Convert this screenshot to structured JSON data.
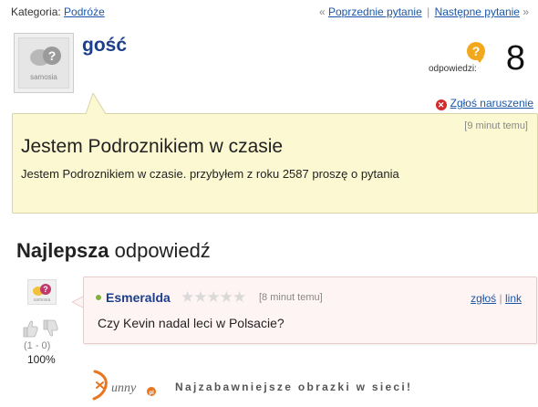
{
  "nav": {
    "category_label": "Kategoria:",
    "category_link": "Podróże",
    "prev_prefix": "«",
    "prev_link": "Poprzednie pytanie",
    "separator": "|",
    "next_link": "Następne pytanie",
    "next_suffix": "»"
  },
  "asker": {
    "avatar_brand": "samosia",
    "name": "gość"
  },
  "answers": {
    "label": "odpowiedzi:",
    "count": "8"
  },
  "report": {
    "label": "Zgłoś naruszenie"
  },
  "question": {
    "time": "[9 minut temu]",
    "title": "Jestem Podroznikiem w czasie",
    "body": "Jestem Podroznikiem w czasie. przybyłem z roku 2587 proszę o pytania"
  },
  "best_answer": {
    "heading_bold": "Najlepsza",
    "heading_rest": " odpowiedź",
    "author": "Esmeralda",
    "rating_stars": 0,
    "rating_max": 5,
    "time": "[8 minut temu]",
    "report_link": "zgłoś",
    "link_link": "link",
    "text": "Czy Kevin nadal leci w Polsacie?",
    "vote_count": "(1 - 0)",
    "vote_percent": "100%"
  },
  "footer": {
    "tagline": "Najzabawniejsze obrazki w sieci!"
  },
  "colors": {
    "link": "#1b57a8",
    "username": "#1b3f8a",
    "question_bg": "#fcf9d2",
    "answer_bg": "#fff4f4",
    "answers_icon": "#f2a81c",
    "report_icon": "#d12b2b"
  }
}
